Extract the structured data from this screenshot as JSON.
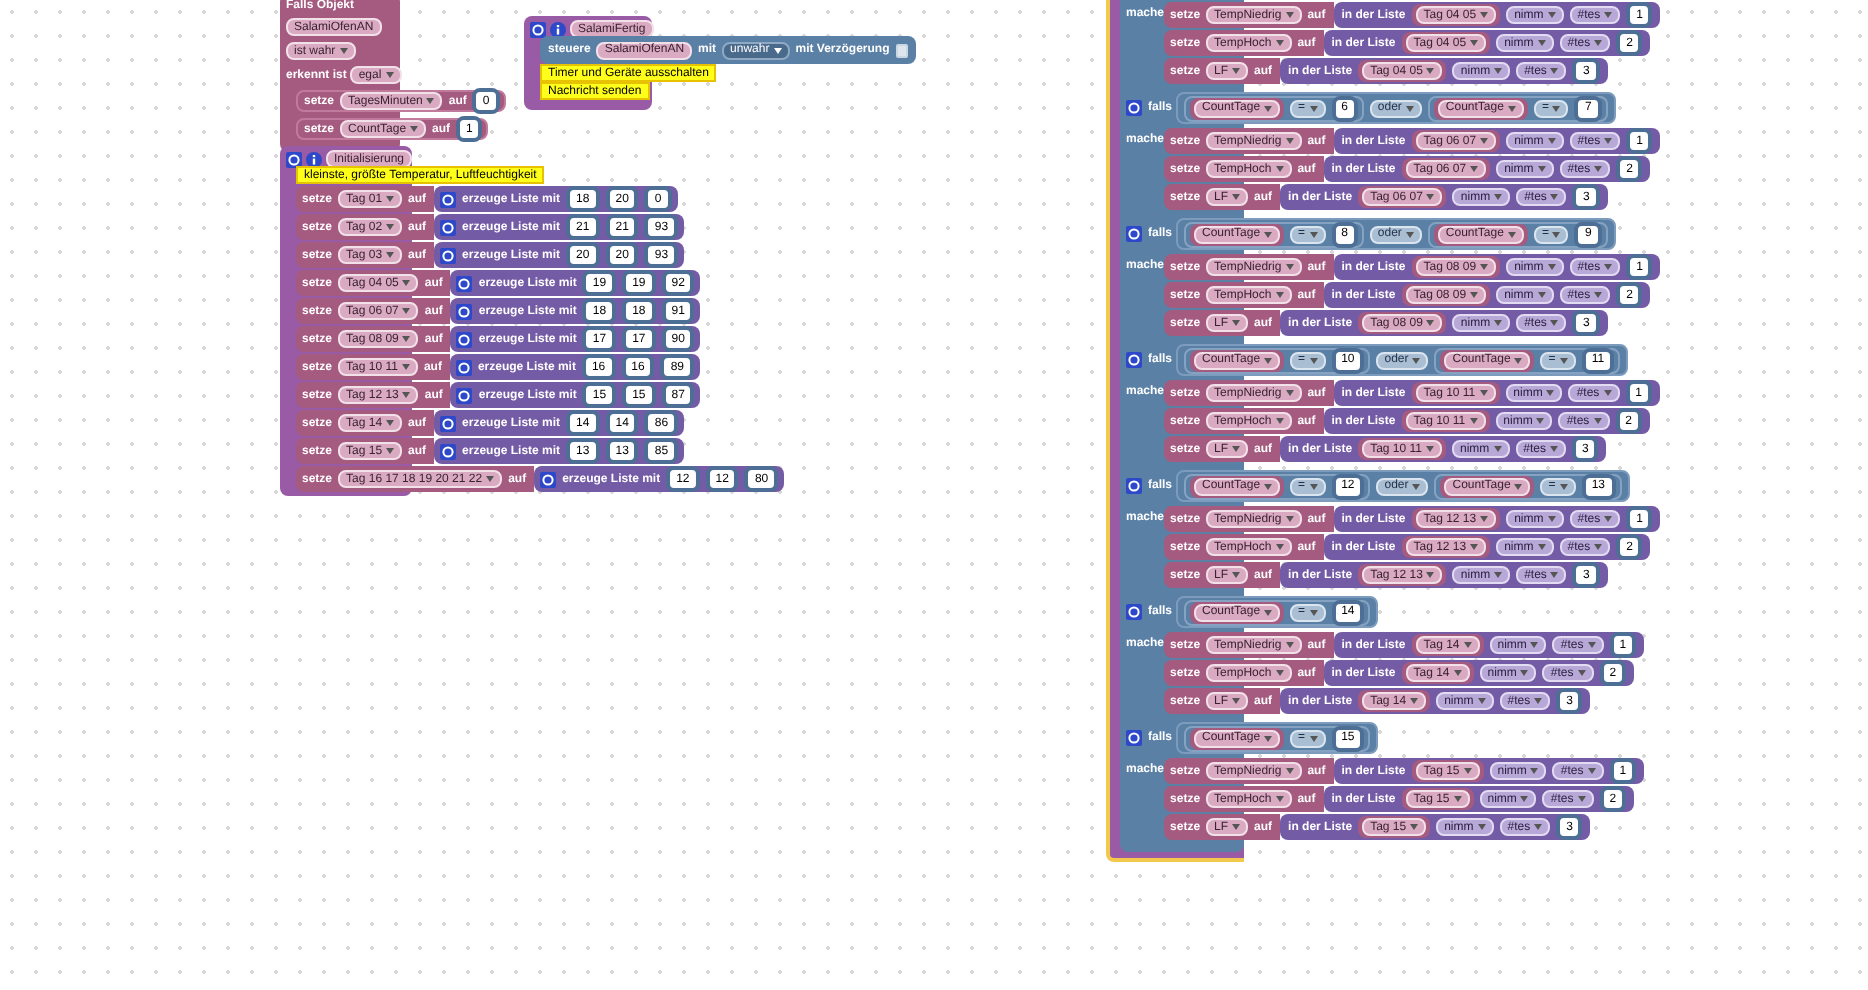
{
  "event_block": {
    "title": "Falls Objekt",
    "object": "SalamiOfenAN",
    "condition": "ist wahr",
    "trigger_label": "erkennt ist",
    "trigger_value": "egal",
    "statements": [
      {
        "keyword": "setze",
        "variable": "TagesMinuten",
        "to": "auf",
        "value": "0"
      },
      {
        "keyword": "setze",
        "variable": "CountTage",
        "to": "auf",
        "value": "1"
      }
    ]
  },
  "function_salami": {
    "name": "SalamiFertig",
    "statement": {
      "keyword": "steuere",
      "object": "SalamiOfenAN",
      "with": "mit",
      "value": "unwahr",
      "delay_label": "mit Verzögerung",
      "delay": false
    },
    "calls": [
      "Timer und Geräte ausschalten",
      "Nachricht senden"
    ]
  },
  "function_init": {
    "name": "Initialisierung",
    "comment": "kleinste, größte Temperatur, Luftfeuchtigkeit",
    "rows": [
      {
        "keyword": "setze",
        "variable": "Tag 01",
        "to": "auf",
        "list": "erzeuge Liste mit",
        "items": [
          "18",
          "20",
          "0"
        ]
      },
      {
        "keyword": "setze",
        "variable": "Tag 02",
        "to": "auf",
        "list": "erzeuge Liste mit",
        "items": [
          "21",
          "21",
          "93"
        ]
      },
      {
        "keyword": "setze",
        "variable": "Tag 03",
        "to": "auf",
        "list": "erzeuge Liste mit",
        "items": [
          "20",
          "20",
          "93"
        ]
      },
      {
        "keyword": "setze",
        "variable": "Tag 04 05",
        "to": "auf",
        "list": "erzeuge Liste mit",
        "items": [
          "19",
          "19",
          "92"
        ]
      },
      {
        "keyword": "setze",
        "variable": "Tag 06 07",
        "to": "auf",
        "list": "erzeuge Liste mit",
        "items": [
          "18",
          "18",
          "91"
        ]
      },
      {
        "keyword": "setze",
        "variable": "Tag 08 09",
        "to": "auf",
        "list": "erzeuge Liste mit",
        "items": [
          "17",
          "17",
          "90"
        ]
      },
      {
        "keyword": "setze",
        "variable": "Tag 10 11",
        "to": "auf",
        "list": "erzeuge Liste mit",
        "items": [
          "16",
          "16",
          "89"
        ]
      },
      {
        "keyword": "setze",
        "variable": "Tag 12 13",
        "to": "auf",
        "list": "erzeuge Liste mit",
        "items": [
          "15",
          "15",
          "87"
        ]
      },
      {
        "keyword": "setze",
        "variable": "Tag 14",
        "to": "auf",
        "list": "erzeuge Liste mit",
        "items": [
          "14",
          "14",
          "86"
        ]
      },
      {
        "keyword": "setze",
        "variable": "Tag 15",
        "to": "auf",
        "list": "erzeuge Liste mit",
        "items": [
          "13",
          "13",
          "85"
        ]
      },
      {
        "keyword": "setze",
        "variable": "Tag 16 17 18 19 20 21 22",
        "to": "auf",
        "list": "erzeuge Liste mit",
        "items": [
          "12",
          "12",
          "80"
        ]
      }
    ]
  },
  "if_block": {
    "branches": [
      {
        "do_label": "mache",
        "rows": [
          {
            "keyword": "setze",
            "variable": "TempNiedrig",
            "to": "auf",
            "list_label": "in der Liste",
            "list": "Tag 04 05",
            "mode": "nimm",
            "where": "#tes",
            "index": "1"
          },
          {
            "keyword": "setze",
            "variable": "TempHoch",
            "to": "auf",
            "list_label": "in der Liste",
            "list": "Tag 04 05",
            "mode": "nimm",
            "where": "#tes",
            "index": "2"
          },
          {
            "keyword": "setze",
            "variable": "LF",
            "to": "auf",
            "list_label": "in der Liste",
            "list": "Tag 04 05",
            "mode": "nimm",
            "where": "#tes",
            "index": "3"
          }
        ]
      },
      {
        "if_label": "falls",
        "terms": [
          {
            "variable": "CountTage",
            "op": "=",
            "value": "6"
          },
          {
            "variable": "CountTage",
            "op": "=",
            "value": "7"
          }
        ],
        "joiner": "oder",
        "do_label": "mache",
        "rows": [
          {
            "keyword": "setze",
            "variable": "TempNiedrig",
            "to": "auf",
            "list_label": "in der Liste",
            "list": "Tag 06 07",
            "mode": "nimm",
            "where": "#tes",
            "index": "1"
          },
          {
            "keyword": "setze",
            "variable": "TempHoch",
            "to": "auf",
            "list_label": "in der Liste",
            "list": "Tag 06 07",
            "mode": "nimm",
            "where": "#tes",
            "index": "2"
          },
          {
            "keyword": "setze",
            "variable": "LF",
            "to": "auf",
            "list_label": "in der Liste",
            "list": "Tag 06 07",
            "mode": "nimm",
            "where": "#tes",
            "index": "3"
          }
        ]
      },
      {
        "if_label": "falls",
        "terms": [
          {
            "variable": "CountTage",
            "op": "=",
            "value": "8"
          },
          {
            "variable": "CountTage",
            "op": "=",
            "value": "9"
          }
        ],
        "joiner": "oder",
        "do_label": "mache",
        "rows": [
          {
            "keyword": "setze",
            "variable": "TempNiedrig",
            "to": "auf",
            "list_label": "in der Liste",
            "list": "Tag 08 09",
            "mode": "nimm",
            "where": "#tes",
            "index": "1"
          },
          {
            "keyword": "setze",
            "variable": "TempHoch",
            "to": "auf",
            "list_label": "in der Liste",
            "list": "Tag 08 09",
            "mode": "nimm",
            "where": "#tes",
            "index": "2"
          },
          {
            "keyword": "setze",
            "variable": "LF",
            "to": "auf",
            "list_label": "in der Liste",
            "list": "Tag 08 09",
            "mode": "nimm",
            "where": "#tes",
            "index": "3"
          }
        ]
      },
      {
        "if_label": "falls",
        "terms": [
          {
            "variable": "CountTage",
            "op": "=",
            "value": "10"
          },
          {
            "variable": "CountTage",
            "op": "=",
            "value": "11"
          }
        ],
        "joiner": "oder",
        "do_label": "mache",
        "rows": [
          {
            "keyword": "setze",
            "variable": "TempNiedrig",
            "to": "auf",
            "list_label": "in der Liste",
            "list": "Tag 10 11",
            "mode": "nimm",
            "where": "#tes",
            "index": "1"
          },
          {
            "keyword": "setze",
            "variable": "TempHoch",
            "to": "auf",
            "list_label": "in der Liste",
            "list": "Tag 10 11",
            "mode": "nimm",
            "where": "#tes",
            "index": "2"
          },
          {
            "keyword": "setze",
            "variable": "LF",
            "to": "auf",
            "list_label": "in der Liste",
            "list": "Tag 10 11",
            "mode": "nimm",
            "where": "#tes",
            "index": "3"
          }
        ]
      },
      {
        "if_label": "falls",
        "terms": [
          {
            "variable": "CountTage",
            "op": "=",
            "value": "12"
          },
          {
            "variable": "CountTage",
            "op": "=",
            "value": "13"
          }
        ],
        "joiner": "oder",
        "do_label": "mache",
        "rows": [
          {
            "keyword": "setze",
            "variable": "TempNiedrig",
            "to": "auf",
            "list_label": "in der Liste",
            "list": "Tag 12 13",
            "mode": "nimm",
            "where": "#tes",
            "index": "1"
          },
          {
            "keyword": "setze",
            "variable": "TempHoch",
            "to": "auf",
            "list_label": "in der Liste",
            "list": "Tag 12 13",
            "mode": "nimm",
            "where": "#tes",
            "index": "2"
          },
          {
            "keyword": "setze",
            "variable": "LF",
            "to": "auf",
            "list_label": "in der Liste",
            "list": "Tag 12 13",
            "mode": "nimm",
            "where": "#tes",
            "index": "3"
          }
        ]
      },
      {
        "if_label": "falls",
        "terms": [
          {
            "variable": "CountTage",
            "op": "=",
            "value": "14"
          }
        ],
        "do_label": "mache",
        "rows": [
          {
            "keyword": "setze",
            "variable": "TempNiedrig",
            "to": "auf",
            "list_label": "in der Liste",
            "list": "Tag 14",
            "mode": "nimm",
            "where": "#tes",
            "index": "1"
          },
          {
            "keyword": "setze",
            "variable": "TempHoch",
            "to": "auf",
            "list_label": "in der Liste",
            "list": "Tag 14",
            "mode": "nimm",
            "where": "#tes",
            "index": "2"
          },
          {
            "keyword": "setze",
            "variable": "LF",
            "to": "auf",
            "list_label": "in der Liste",
            "list": "Tag 14",
            "mode": "nimm",
            "where": "#tes",
            "index": "3"
          }
        ]
      },
      {
        "if_label": "falls",
        "terms": [
          {
            "variable": "CountTage",
            "op": "=",
            "value": "15"
          }
        ],
        "do_label": "mache",
        "rows": [
          {
            "keyword": "setze",
            "variable": "TempNiedrig",
            "to": "auf",
            "list_label": "in der Liste",
            "list": "Tag 15",
            "mode": "nimm",
            "where": "#tes",
            "index": "1"
          },
          {
            "keyword": "setze",
            "variable": "TempHoch",
            "to": "auf",
            "list_label": "in der Liste",
            "list": "Tag 15",
            "mode": "nimm",
            "where": "#tes",
            "index": "2"
          },
          {
            "keyword": "setze",
            "variable": "LF",
            "to": "auf",
            "list_label": "in der Liste",
            "list": "Tag 15",
            "mode": "nimm",
            "where": "#tes",
            "index": "3"
          }
        ]
      }
    ]
  }
}
